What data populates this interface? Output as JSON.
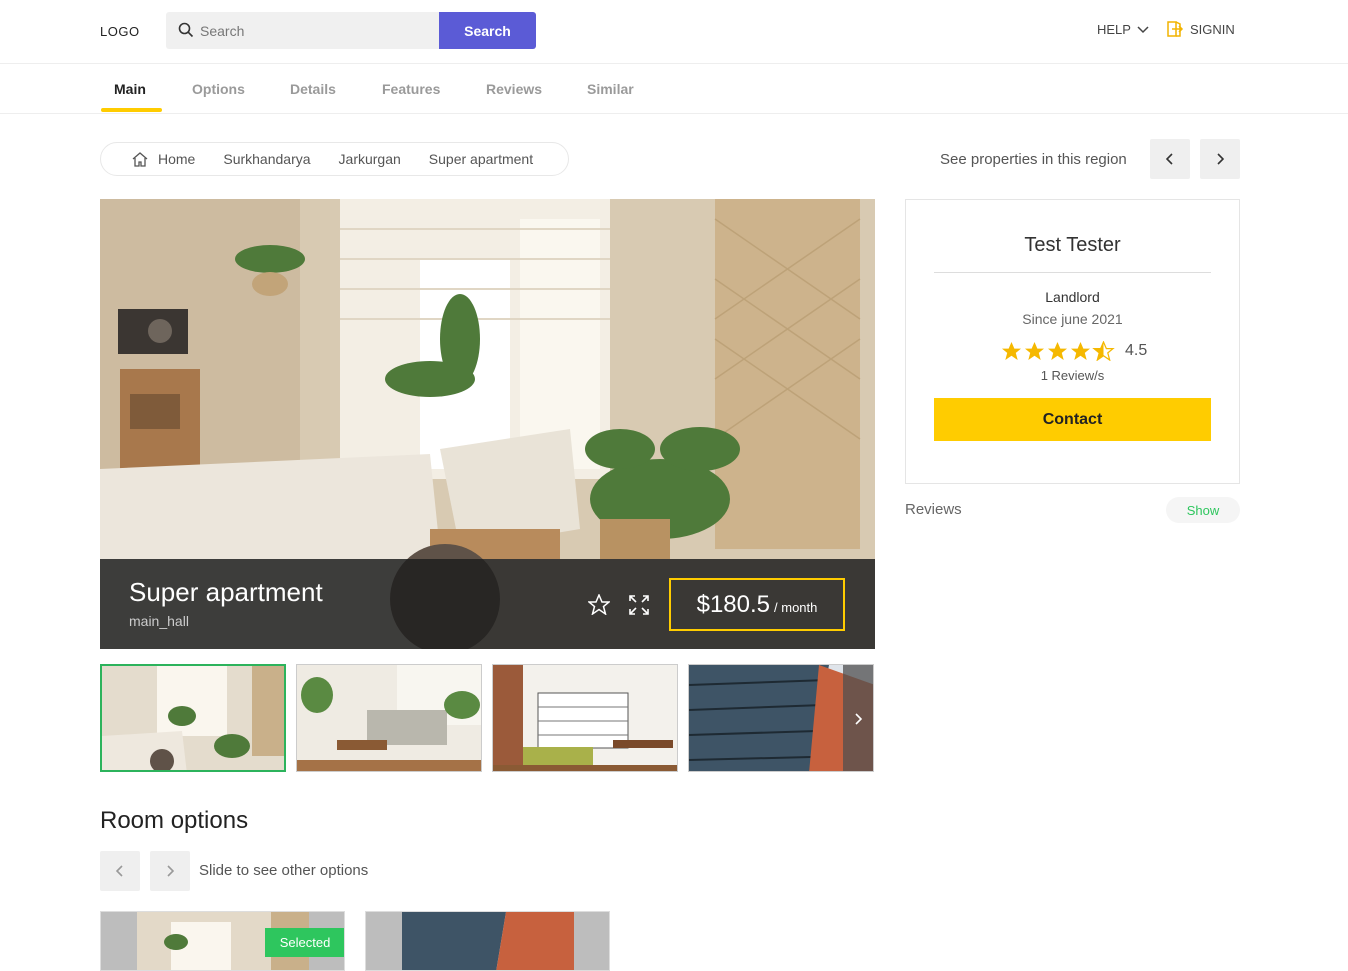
{
  "header": {
    "logo": "LOGO",
    "search_placeholder": "Search",
    "search_button": "Search",
    "help": "HELP",
    "signin": "SIGNIN"
  },
  "tabs": [
    "Main",
    "Options",
    "Details",
    "Features",
    "Reviews",
    "Similar"
  ],
  "active_tab": "Main",
  "breadcrumb": [
    "Home",
    "Surkhandarya",
    "Jarkurgan",
    "Super apartment"
  ],
  "region_text": "See properties in this region",
  "hero": {
    "title": "Super apartment",
    "subtitle": "main_hall",
    "price": "$180.5",
    "per": "/ month"
  },
  "host": {
    "name": "Test Tester",
    "role": "Landlord",
    "since": "Since june 2021",
    "rating_value": 4.5,
    "rating_label": "4.5",
    "reviews_count": "1 Review/s",
    "contact_button": "Contact"
  },
  "reviews": {
    "label": "Reviews",
    "show_button": "Show"
  },
  "room_options": {
    "title": "Room options",
    "slide_text": "Slide to see other options",
    "selected_badge": "Selected"
  },
  "colors": {
    "accent_yellow": "#ffcc00",
    "search_button": "#5b5bd6",
    "selected_green": "#2ec65e"
  }
}
